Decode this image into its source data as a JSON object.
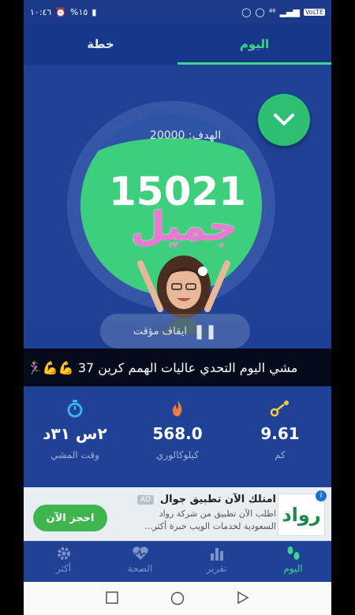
{
  "status_bar": {
    "time": "١٠:٤٦",
    "battery": "%١٥",
    "right_text": "⁴⁶",
    "volte": "VoLTE"
  },
  "tabs": {
    "today": "اليوم",
    "plan": "خطة"
  },
  "progress": {
    "goal_label": "الهدف: 20000",
    "steps": "15021",
    "sticker_text": "جميل",
    "pause_label": "ايقاف مؤقت",
    "goal_fraction": 0.75
  },
  "caption": {
    "text": "مشي اليوم التحدي عاليات الهمم كرين 37 💪💪🏃‍♀️"
  },
  "stats": [
    {
      "value": "9.61",
      "label": "كم",
      "icon": "route-icon",
      "color": "#f7c948"
    },
    {
      "value": "568.0",
      "label": "كيلوكالوري",
      "icon": "flame-icon",
      "color": "#f07c3e"
    },
    {
      "value": "٢س ٣١د",
      "label": "وقت المشي",
      "icon": "timer-icon",
      "color": "#3ab0f2"
    }
  ],
  "ad": {
    "title": "امتلك الآن تطبيق جوال",
    "badge": "AD",
    "description": "اطلب الآن تطبيق من شركة رواد السعودية لخدمات الويب خبرة أكثر...",
    "cta": "احجز الآن",
    "logo_text": "رواد"
  },
  "bottom_nav": [
    {
      "label": "اليوم",
      "icon": "footsteps-icon",
      "active": true
    },
    {
      "label": "تقرير",
      "icon": "bar-chart-icon",
      "active": false
    },
    {
      "label": "الصحة",
      "icon": "heart-pulse-icon",
      "active": false
    },
    {
      "label": "أكثر",
      "icon": "gear-icon",
      "active": false
    }
  ],
  "colors": {
    "accent_green": "#3ed68b",
    "background": "#1f4296",
    "fill_green": "#3ecf7e"
  }
}
